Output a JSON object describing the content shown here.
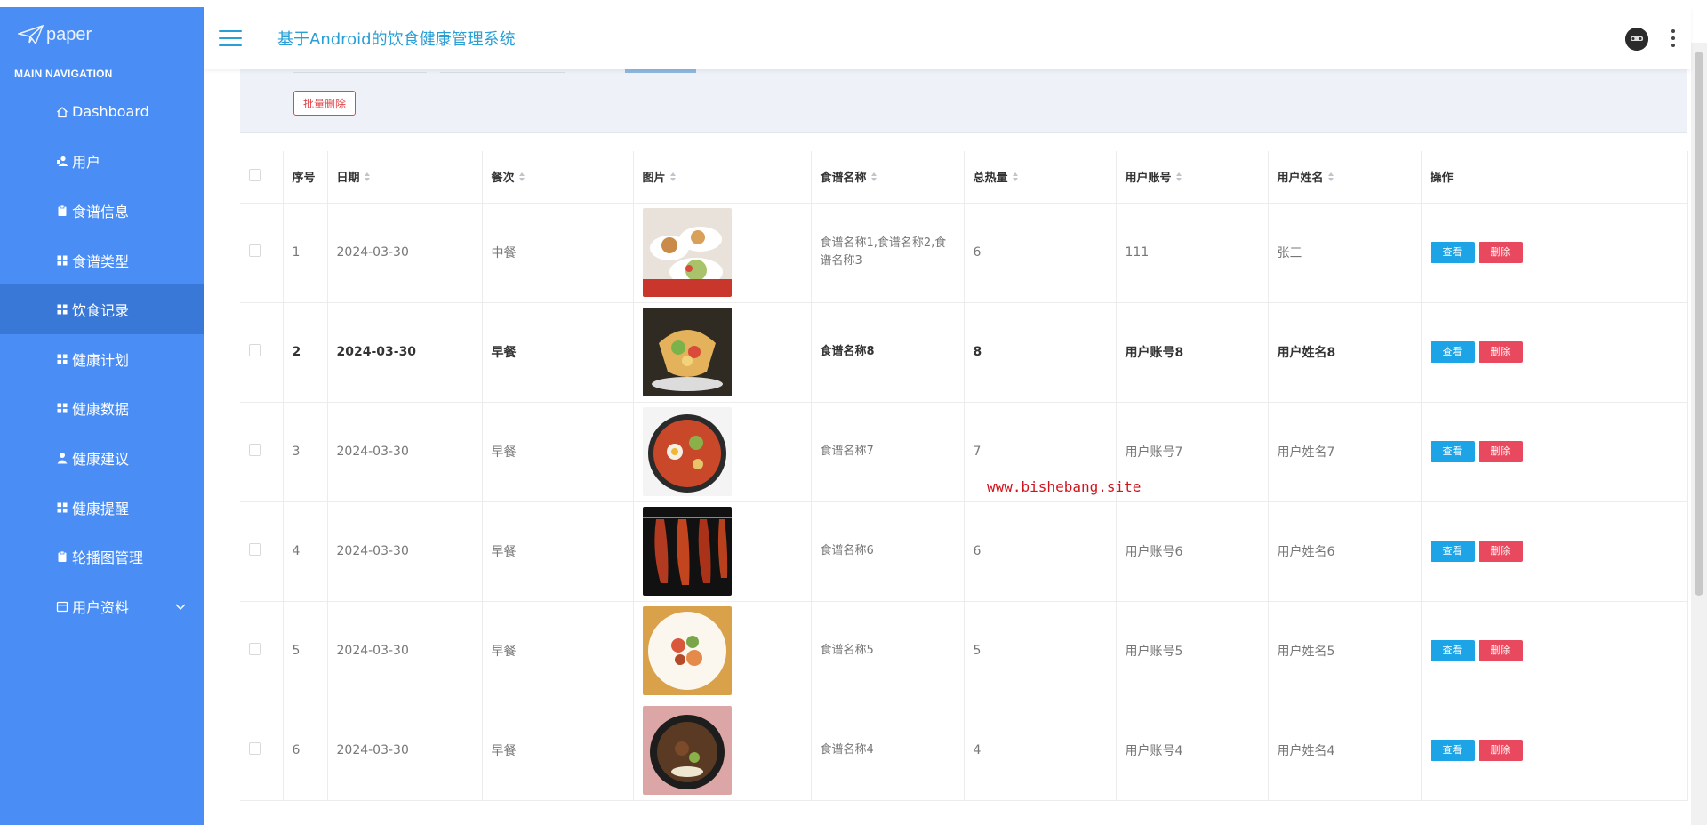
{
  "brand": {
    "name": "paper"
  },
  "nav": {
    "heading": "MAIN NAVIGATION",
    "items": [
      {
        "label": "Dashboard",
        "icon": "home-icon"
      },
      {
        "label": "用户",
        "icon": "user-group-icon"
      },
      {
        "label": "食谱信息",
        "icon": "clipboard-icon"
      },
      {
        "label": "食谱类型",
        "icon": "grid-icon"
      },
      {
        "label": "饮食记录",
        "icon": "grid-icon",
        "active": true
      },
      {
        "label": "健康计划",
        "icon": "grid-icon"
      },
      {
        "label": "健康数据",
        "icon": "grid-icon"
      },
      {
        "label": "健康建议",
        "icon": "user-icon"
      },
      {
        "label": "健康提醒",
        "icon": "grid-icon"
      },
      {
        "label": "轮播图管理",
        "icon": "clipboard-icon"
      },
      {
        "label": "用户资料",
        "icon": "calendar-icon",
        "expandable": true
      }
    ]
  },
  "header": {
    "title": "基于Android的饮食健康管理系统"
  },
  "toolbar": {
    "batch_delete": "批量删除"
  },
  "table": {
    "columns": [
      "序号",
      "日期",
      "餐次",
      "图片",
      "食谱名称",
      "总热量",
      "用户账号",
      "用户姓名",
      "操作"
    ],
    "rows": [
      {
        "index": "1",
        "date": "2024-03-30",
        "meal": "中餐",
        "recipe": "食谱名称1,食谱名称2,食谱名称3",
        "calories": "6",
        "account": "111",
        "name": "张三"
      },
      {
        "index": "2",
        "date": "2024-03-30",
        "meal": "早餐",
        "recipe": "食谱名称8",
        "calories": "8",
        "account": "用户账号8",
        "name": "用户姓名8",
        "bold": true
      },
      {
        "index": "3",
        "date": "2024-03-30",
        "meal": "早餐",
        "recipe": "食谱名称7",
        "calories": "7",
        "account": "用户账号7",
        "name": "用户姓名7"
      },
      {
        "index": "4",
        "date": "2024-03-30",
        "meal": "早餐",
        "recipe": "食谱名称6",
        "calories": "6",
        "account": "用户账号6",
        "name": "用户姓名6"
      },
      {
        "index": "5",
        "date": "2024-03-30",
        "meal": "早餐",
        "recipe": "食谱名称5",
        "calories": "5",
        "account": "用户账号5",
        "name": "用户姓名5"
      },
      {
        "index": "6",
        "date": "2024-03-30",
        "meal": "早餐",
        "recipe": "食谱名称4",
        "calories": "4",
        "account": "用户账号4",
        "name": "用户姓名4"
      }
    ],
    "actions": {
      "view": "查看",
      "delete": "删除"
    }
  },
  "watermark": "www.bishebang.site",
  "colors": {
    "sidebar": "#4a8df4",
    "sidebar_active": "#3a78d8",
    "title": "#2a9fd6",
    "view_button": "#1da4e6",
    "delete_button": "#e9495f"
  }
}
